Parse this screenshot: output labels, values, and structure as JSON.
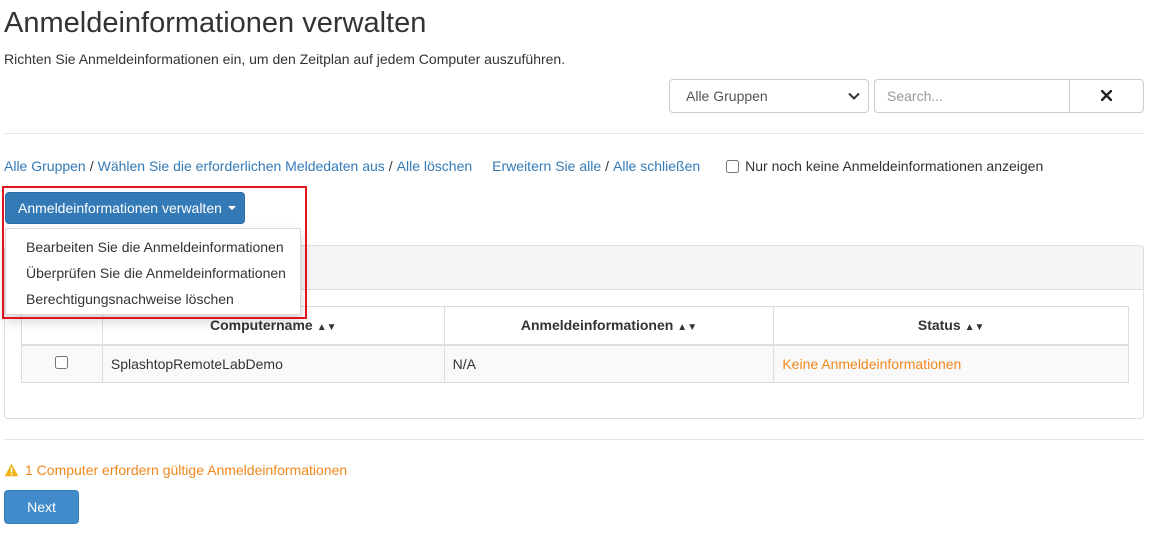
{
  "page": {
    "title": "Anmeldeinformationen verwalten",
    "subtitle": "Richten Sie Anmeldeinformationen ein, um den Zeitplan auf jedem Computer auszuführen."
  },
  "toolbar": {
    "group_select": {
      "selected": "Alle Gruppen"
    },
    "search": {
      "placeholder": "Search...",
      "value": ""
    },
    "clear_icon": "close-icon"
  },
  "filters": {
    "all_groups": "Alle Gruppen",
    "select_required": "Wählen Sie die erforderlichen Meldedaten aus",
    "clear_all": "Alle löschen",
    "expand_all": "Erweitern Sie alle",
    "collapse_all": "Alle schließen",
    "separator": "/",
    "only_missing_label": "Nur noch keine Anmeldeinformationen anzeigen"
  },
  "manage_menu": {
    "button_label": "Anmeldeinformationen verwalten",
    "items": [
      "Bearbeiten Sie die Anmeldeinformationen",
      "Überprüfen Sie die Anmeldeinformationen",
      "Berechtigungsnachweise löschen"
    ]
  },
  "table": {
    "columns": [
      "Computername",
      "Anmeldeinformationen",
      "Status"
    ],
    "rows": [
      {
        "computer": "SplashtopRemoteLabDemo",
        "credentials": "N/A",
        "status": "Keine Anmeldeinformationen"
      }
    ]
  },
  "footer": {
    "warning": "1 Computer erfordern gültige Anmeldeinformationen",
    "next_label": "Next"
  },
  "colors": {
    "link": "#337ab7",
    "primary": "#337ab7",
    "warning": "#f0871d",
    "highlight": "#e0141e"
  }
}
